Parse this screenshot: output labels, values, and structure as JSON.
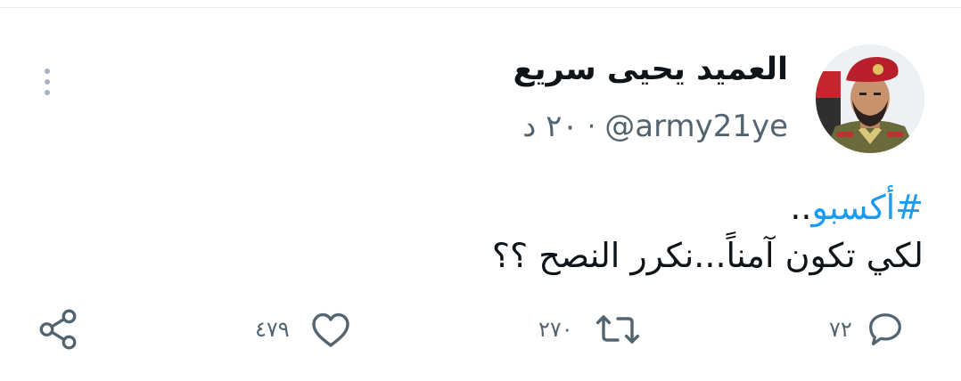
{
  "tweet": {
    "author": {
      "display_name": "العميد يحيى سريع",
      "handle": "@army21ye"
    },
    "time_ago": "٢٠ د",
    "separator": "·",
    "text": {
      "hashtag": "#أكسبو",
      "hashtag_suffix": "..",
      "line2": "لكي تكون آمناً...نكرر النصح ؟؟"
    },
    "actions": {
      "reply_count": "٧٢",
      "retweet_count": "٢٧٠",
      "like_count": "٤٧٩"
    },
    "colors": {
      "accent": "#1d9bf0",
      "secondary_text": "#536471",
      "icon": "#536471"
    },
    "icons": {
      "reply": "speech-bubble-icon",
      "retweet": "retweet-icon",
      "like": "heart-icon",
      "share": "share-nodes-icon",
      "more": "vertical-dots-icon"
    }
  }
}
